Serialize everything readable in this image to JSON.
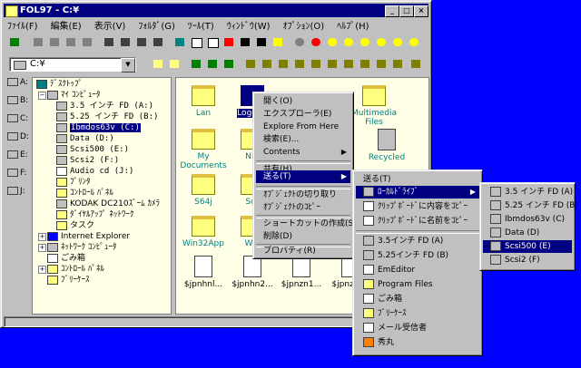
{
  "window": {
    "title": "FOL97 - C:¥",
    "menu": [
      "ﾌｧｲﾙ(F)",
      "編集(E)",
      "表示(V)",
      "ﾌｫﾙﾀﾞ(G)",
      "ﾂｰﾙ(T)",
      "ｳｨﾝﾄﾞｳ(W)",
      "ｵﾌﾟｼｮﾝ(O)",
      "ﾍﾙﾌﾟ(H)"
    ]
  },
  "address": {
    "value": "C:¥"
  },
  "drive_strip": [
    "A:",
    "B:",
    "C:",
    "D:",
    "E:",
    "F:",
    "J:"
  ],
  "tree": {
    "items": [
      {
        "label": "ﾃﾞｽｸﾄｯﾌﾟ"
      },
      {
        "label": "ﾏｲ ｺﾝﾋﾟｭｰﾀ"
      },
      {
        "label": "3.5 インチ FD (A:)"
      },
      {
        "label": "5.25 インチ FD (B:)"
      },
      {
        "label": "Ibmdos63v (C:)"
      },
      {
        "label": "Data (D:)"
      },
      {
        "label": "Scsi500 (E:)"
      },
      {
        "label": "Scsi2 (F:)"
      },
      {
        "label": "Audio cd (J:)"
      },
      {
        "label": "ﾌﾟﾘﾝﾀ"
      },
      {
        "label": "ｺﾝﾄﾛｰﾙ ﾊﾟﾈﾙ"
      },
      {
        "label": "KODAK DC210ｽﾞｰﾑ ｶﾒﾗ"
      },
      {
        "label": "ﾀﾞｲﾔﾙｱｯﾌﾟ ﾈｯﾄﾜｰｸ"
      },
      {
        "label": "タスク"
      },
      {
        "label": "Internet Explorer"
      },
      {
        "label": "ﾈｯﾄﾜｰｸ ｺﾝﾋﾟｭｰﾀ"
      },
      {
        "label": "ごみ箱"
      },
      {
        "label": "ｺﾝﾄﾛｰﾙ ﾊﾟﾈﾙ"
      },
      {
        "label": "ﾌﾞﾘｰｹｰｽ"
      }
    ]
  },
  "files": [
    {
      "label": "Lan"
    },
    {
      "label": "LogoCh"
    },
    {
      "label": "Multimedia Files"
    },
    {
      "label": "My Documents"
    },
    {
      "label": "Nift"
    },
    {
      "label": "Recycled"
    },
    {
      "label": "S64j"
    },
    {
      "label": "Scs"
    },
    {
      "label": "Win32App"
    },
    {
      "label": "Win"
    },
    {
      "label": "$jpnhnl..."
    },
    {
      "label": "$jpnhn2..."
    },
    {
      "label": "$jpnzn1..."
    },
    {
      "label": "$jpnznl..."
    }
  ],
  "context_menu": {
    "items": [
      "開く(O)",
      "エクスプローラ(E)",
      "Explore From Here",
      "検索(E)...",
      "Contents",
      "共有(H)...",
      "送る(T)",
      "ｵﾌﾞｼﾞｪｸﾄの切り取り",
      "ｵﾌﾞｼﾞｪｸﾄのｺﾋﾟｰ",
      "ショートカットの作成(S)",
      "削除(D)",
      "プロパティ(R)"
    ]
  },
  "sendto_menu": {
    "items": [
      "送る(T)",
      "ﾛｰｶﾙﾄﾞﾗｲﾌﾞ",
      "ｸﾘｯﾌﾟﾎﾞｰﾄﾞに内容をｺﾋﾟｰ",
      "ｸﾘｯﾌﾟﾎﾞｰﾄﾞに名前をｺﾋﾟｰ",
      "3.5インチ FD (A)",
      "5.25インチ FD (B)",
      "EmEditor",
      "Program Files",
      "ごみ箱",
      "ﾌﾞﾘｰｹｰｽ",
      "メール受信者",
      "秀丸"
    ]
  },
  "drive_menu": {
    "items": [
      "3.5 インチ FD (A)",
      "5.25 インチ FD (B)",
      "Ibmdos63v (C)",
      "Data (D)",
      "Scsi500 (E)",
      "Scsi2 (F)"
    ]
  }
}
